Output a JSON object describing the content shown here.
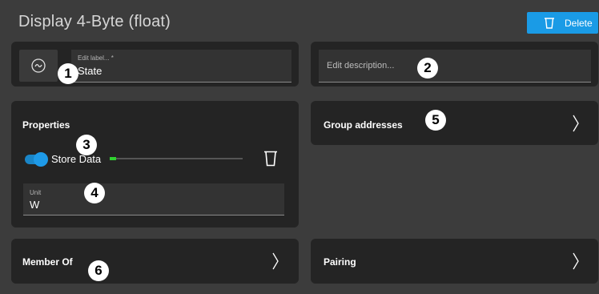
{
  "header": {
    "title": "Display 4-Byte (float)",
    "delete_label": "Delete"
  },
  "label_field": {
    "small_label": "Edit label... *",
    "value": "State",
    "icon": "tilde-circle-icon"
  },
  "description_field": {
    "placeholder": "Edit description..."
  },
  "properties": {
    "heading": "Properties",
    "toggle_label": "Store Data",
    "toggle_on": true,
    "store_level": 0.05,
    "unit_label": "Unit",
    "unit_value": "W"
  },
  "group_addresses": {
    "label": "Group addresses"
  },
  "member_of": {
    "label": "Member Of"
  },
  "pairing": {
    "label": "Pairing"
  },
  "markers": [
    "1",
    "2",
    "3",
    "4",
    "5",
    "6"
  ],
  "colors": {
    "accent": "#1a9be6",
    "card": "#242424",
    "background": "#3c3c3c",
    "progress": "#2fd12f"
  }
}
